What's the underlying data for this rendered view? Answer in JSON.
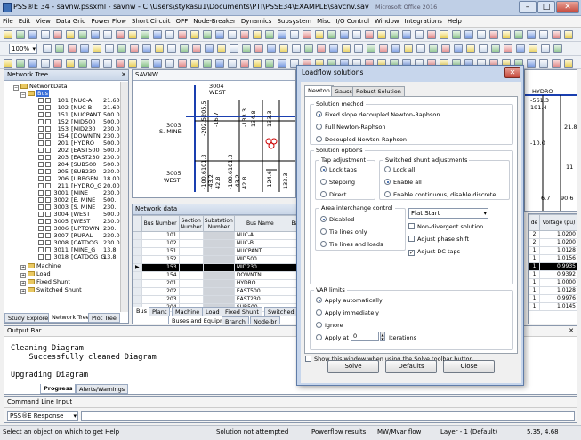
{
  "window": {
    "title": "PSS®E 34 - savnw.pssxml - savnw - C:\\Users\\stykasu1\\Documents\\PTI\\PSSE34\\EXAMPLE\\savcnv.sav"
  },
  "menu": [
    "File",
    "Edit",
    "View",
    "Data Grid",
    "Power Flow",
    "Short Circuit",
    "OPF",
    "Node-Breaker",
    "Dynamics",
    "Subsystem",
    "Misc",
    "I/O Control",
    "Window",
    "Integrations",
    "Help"
  ],
  "toolbar": {
    "zoom": "100%"
  },
  "network_tree": {
    "title": "Network Tree",
    "root": "NetworkData",
    "bus_folder": "Bus",
    "buses": [
      {
        "num": "101",
        "name": "[NUC-A",
        "kv": "21.600]"
      },
      {
        "num": "102",
        "name": "[NUC-B",
        "kv": "21.600]"
      },
      {
        "num": "151",
        "name": "[NUCPANT",
        "kv": "500.000]"
      },
      {
        "num": "152",
        "name": "[MID500",
        "kv": "500.000]"
      },
      {
        "num": "153",
        "name": "[MID230",
        "kv": "230.000]"
      },
      {
        "num": "154",
        "name": "[DOWNTN",
        "kv": "230.00"
      },
      {
        "num": "201",
        "name": "[HYDRO",
        "kv": "500.00"
      },
      {
        "num": "202",
        "name": "[EAST500",
        "kv": "500.00"
      },
      {
        "num": "203",
        "name": "[EAST230",
        "kv": "230.00"
      },
      {
        "num": "204",
        "name": "[SUB500",
        "kv": "500.00"
      },
      {
        "num": "205",
        "name": "[SUB230",
        "kv": "230.00"
      },
      {
        "num": "206",
        "name": "[URBGEN",
        "kv": "18.000"
      },
      {
        "num": "211",
        "name": "[HYDRO_G",
        "kv": "20.00"
      },
      {
        "num": "3001",
        "name": "[MINE",
        "kv": "230.00"
      },
      {
        "num": "3002",
        "name": "[E. MINE",
        "kv": "500."
      },
      {
        "num": "3003",
        "name": "[S. MINE",
        "kv": "230."
      },
      {
        "num": "3004",
        "name": "[WEST",
        "kv": "500.0"
      },
      {
        "num": "3005",
        "name": "[WEST",
        "kv": "230.0"
      },
      {
        "num": "3006",
        "name": "[UPTOWN",
        "kv": "230."
      },
      {
        "num": "3007",
        "name": "[RURAL",
        "kv": "230.0"
      },
      {
        "num": "3008",
        "name": "[CATDOG",
        "kv": "230.0"
      },
      {
        "num": "3011",
        "name": "[MINE_G",
        "kv": "13.8"
      },
      {
        "num": "3018",
        "name": "[CATDOG_G",
        "kv": "13.8"
      }
    ],
    "folders": [
      "Machine",
      "Load",
      "Fixed Shunt",
      "Switched Shunt"
    ],
    "tabs": [
      "Study Explorer",
      "Network Tree",
      "Plot Tree"
    ]
  },
  "diagram": {
    "title": "SAVNW",
    "labels": {
      "bus3004_num": "3004",
      "bus3004_name": "WEST",
      "bus3003_num": "3003",
      "bus3003_name": "S. MINE",
      "bus3005_num": "3005",
      "bus3005_name": "WEST",
      "v1": "-202.5205.5",
      "v2": "-16.7",
      "v3": "-133.3",
      "v4": "134.8",
      "v5": "-100.6101.3",
      "v6": "-43.2",
      "v7": "42.8",
      "v8": "-100.6101.3",
      "v9": "-43.2",
      "v10": "42.8",
      "v11": "133.3",
      "v12": "-124.6",
      "v13": "133.3"
    }
  },
  "network_data": {
    "title": "Network data",
    "columns": [
      "Bus Number",
      "Section Number",
      "Substation Number",
      "Bus Name",
      "Ba"
    ],
    "rows": [
      {
        "bus": "101",
        "name": "NUC-A"
      },
      {
        "bus": "102",
        "name": "NUC-B"
      },
      {
        "bus": "151",
        "name": "NUCPANT"
      },
      {
        "bus": "152",
        "name": "MID500"
      },
      {
        "bus": "153",
        "name": "MID230"
      },
      {
        "bus": "154",
        "name": "DOWNTN"
      },
      {
        "bus": "201",
        "name": "HYDRO"
      },
      {
        "bus": "202",
        "name": "EAST500"
      },
      {
        "bus": "203",
        "name": "EAST230"
      },
      {
        "bus": "204",
        "name": "SUB500"
      }
    ],
    "tabs": [
      "Bus",
      "Plant",
      "Machine",
      "Load",
      "Fixed Shunt",
      "Switched"
    ],
    "subtabs": [
      "Buses and Equipment",
      "Branch",
      "Node-br"
    ]
  },
  "right_grid": {
    "col_code": "de",
    "col_voltage": "Voltage (pu)",
    "rows": [
      {
        "code": "2",
        "v": "1.0200"
      },
      {
        "code": "2",
        "v": "1.0200"
      },
      {
        "code": "1",
        "v": "1.0128"
      },
      {
        "code": "1",
        "v": "1.0156"
      },
      {
        "code": "1",
        "v": "0.9935"
      },
      {
        "code": "1",
        "v": "0.9392"
      },
      {
        "code": "1",
        "v": "1.0000"
      },
      {
        "code": "1",
        "v": "1.0128"
      },
      {
        "code": "1",
        "v": "0.9976"
      },
      {
        "code": "1",
        "v": "1.0145"
      }
    ]
  },
  "right_diagram": {
    "a": "HYDRO",
    "b": "-561.3",
    "c": "191.4",
    "d": "-10.0",
    "e": "6.7",
    "f": "90.6",
    "g": "11",
    "h": "21.8"
  },
  "output": {
    "title": "Output Bar",
    "lines": [
      "Cleaning Diagram",
      "    Successfully cleaned Diagram",
      "",
      "Upgrading Diagram"
    ],
    "tabs": [
      "Progress",
      "Alerts/Warnings"
    ]
  },
  "command_line": {
    "title": "Command Line Input",
    "mode": "PSS®E Response"
  },
  "status": {
    "hint": "Select an object on which to get Help",
    "solution": "Solution not attempted",
    "results": "Powerflow results",
    "units": "MW/Mvar flow",
    "layer": "Layer - 1 (Default)",
    "coords": "5.35, 4.68"
  },
  "dialog": {
    "title": "Loadflow solutions",
    "tabs": [
      "Newton",
      "Gauss",
      "Robust Solution"
    ],
    "solution_method": {
      "title": "Solution method",
      "options": [
        "Fixed slope decoupled Newton-Raphson",
        "Full Newton-Raphson",
        "Decoupled Newton-Raphson"
      ]
    },
    "solution_options": {
      "title": "Solution options"
    },
    "tap_adjustment": {
      "title": "Tap adjustment",
      "options": [
        "Lock taps",
        "Stepping",
        "Direct"
      ]
    },
    "switched_shunt": {
      "title": "Switched shunt adjustments",
      "options": [
        "Lock all",
        "Enable all",
        "Enable continuous, disable discrete"
      ]
    },
    "area_interchange": {
      "title": "Area interchange control",
      "options": [
        "Disabled",
        "Tie lines only",
        "Tie lines and loads"
      ]
    },
    "flat_start": "Flat Start",
    "checks": [
      "Non-divergent solution",
      "Adjust phase shift",
      "Adjust DC taps"
    ],
    "var_limits": {
      "title": "VAR limits",
      "options": [
        "Apply automatically",
        "Apply immediately",
        "Ignore",
        "Apply at"
      ],
      "iterations_value": "0",
      "iterations_label": "Iterations"
    },
    "show_window": "Show this window when using the Solve toolbar button",
    "buttons": {
      "solve": "Solve",
      "defaults": "Defaults",
      "close": "Close"
    }
  },
  "bg_window": "Microsoft Office 2016"
}
